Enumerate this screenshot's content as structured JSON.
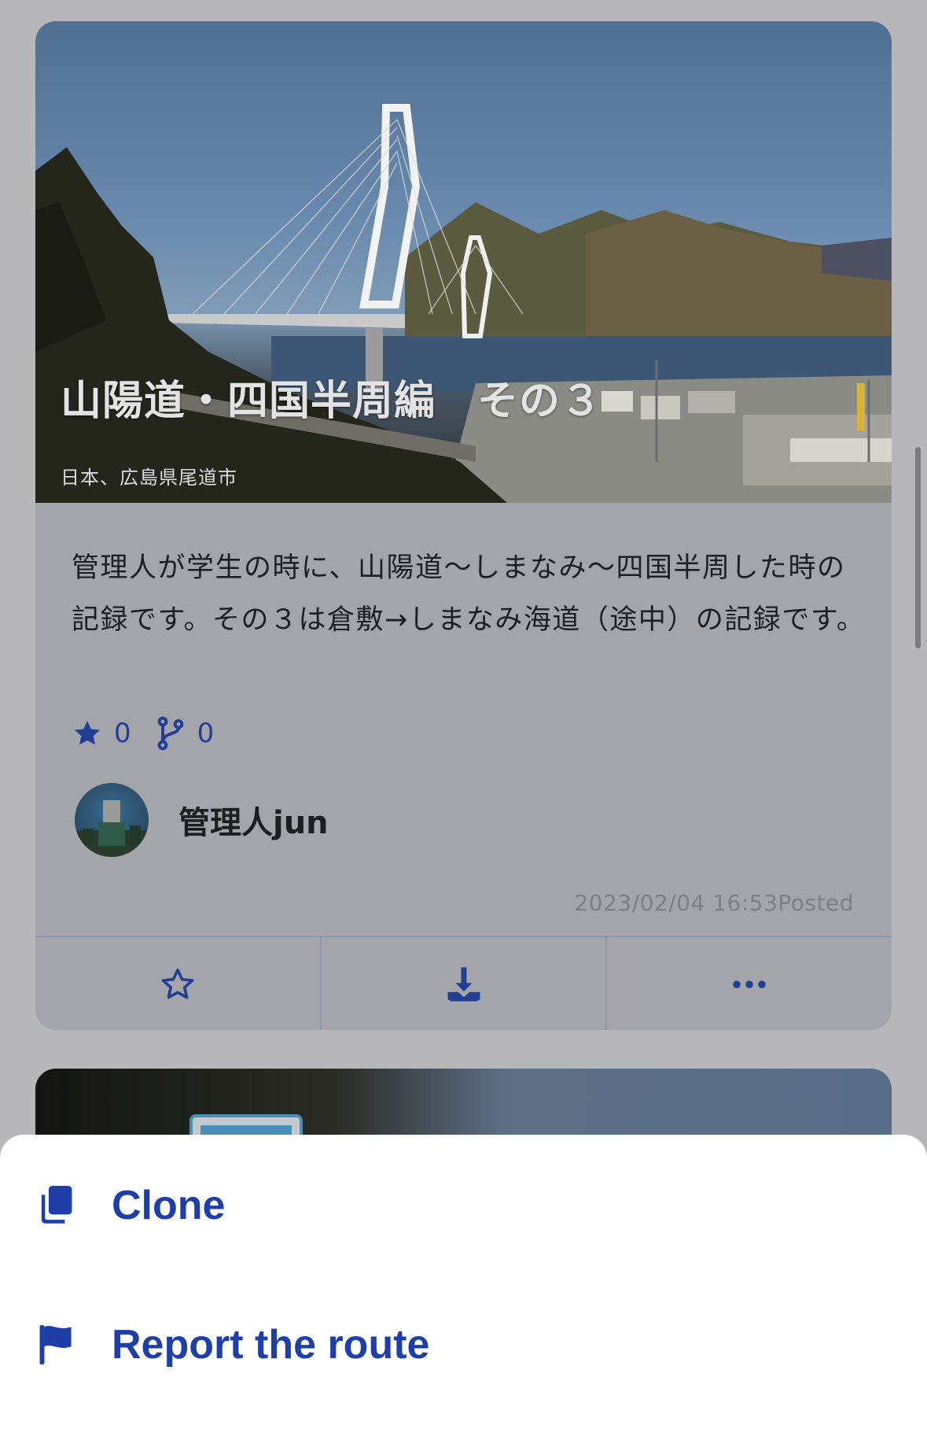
{
  "route_card": {
    "title": "山陽道・四国半周編　その３",
    "location": "日本、広島県尾道市",
    "description": "管理人が学生の時に、山陽道〜しまなみ〜四国半周した時の記録です。その３は倉敷→しまなみ海道（途中）の記録です。",
    "stars_count": "0",
    "forks_count": "0",
    "author_name": "管理人jun",
    "posted_at": "2023/02/04 16:53Posted",
    "actions": [
      "star-icon",
      "download-icon",
      "more-icon"
    ]
  },
  "action_sheet": {
    "clone_label": "Clone",
    "report_label": "Report the route"
  },
  "colors": {
    "accent": "#1f3fa8",
    "dim_overlay": "#b7b7b9",
    "sheet_background": "#ffffff"
  }
}
